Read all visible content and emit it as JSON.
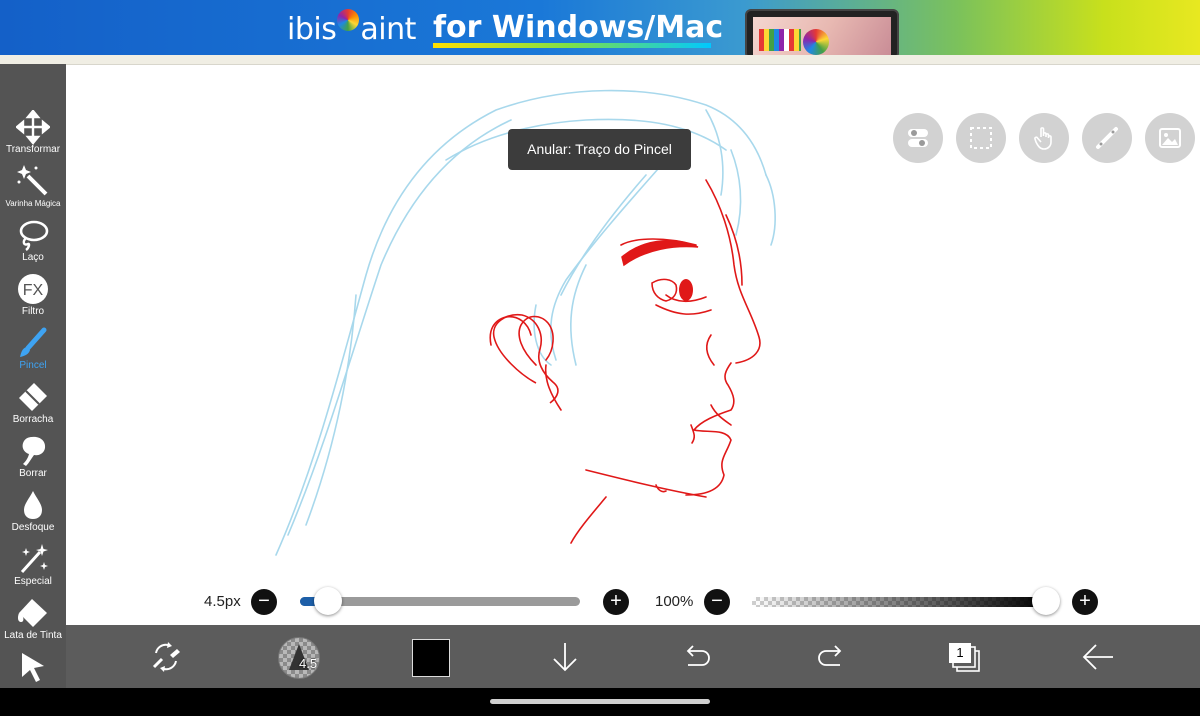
{
  "banner": {
    "logo_prefix": "ibis",
    "logo_suffix": "aint",
    "tagline": "for Windows/Mac"
  },
  "tools": [
    {
      "label": "Transformar",
      "icon": "move-arrows-icon"
    },
    {
      "label": "Varinha Mágica",
      "icon": "magic-wand-icon"
    },
    {
      "label": "Laço",
      "icon": "lasso-icon"
    },
    {
      "label": "Filtro",
      "icon": "fx-filter-icon",
      "glyph": "FX"
    },
    {
      "label": "Pincel",
      "icon": "brush-icon",
      "active": true
    },
    {
      "label": "Borracha",
      "icon": "eraser-icon"
    },
    {
      "label": "Borrar",
      "icon": "smudge-icon"
    },
    {
      "label": "Desfoque",
      "icon": "blur-drop-icon"
    },
    {
      "label": "Especial",
      "icon": "special-sparkle-icon"
    },
    {
      "label": "Lata de Tinta",
      "icon": "paint-bucket-icon"
    },
    {
      "label": "",
      "icon": "select-arrow-icon"
    }
  ],
  "tooltip": "Anular: Traço do Pincel",
  "floating_buttons": [
    "toggle-icon",
    "selection-icon",
    "hand-touch-icon",
    "ruler-icon",
    "image-icon"
  ],
  "brush": {
    "size_label": "4.5px",
    "size_fraction": 0.1,
    "opacity_label": "100%",
    "opacity_fraction": 1.0,
    "preview_label": "4.5"
  },
  "bottombar": {
    "current_color": "#000000",
    "layer_count": "1"
  },
  "colors": {
    "sketch_blue": "#a8d8ec",
    "ink_red": "#e01818",
    "active_tool": "#3ea3f2",
    "size_fill": "#1d5fa8"
  }
}
